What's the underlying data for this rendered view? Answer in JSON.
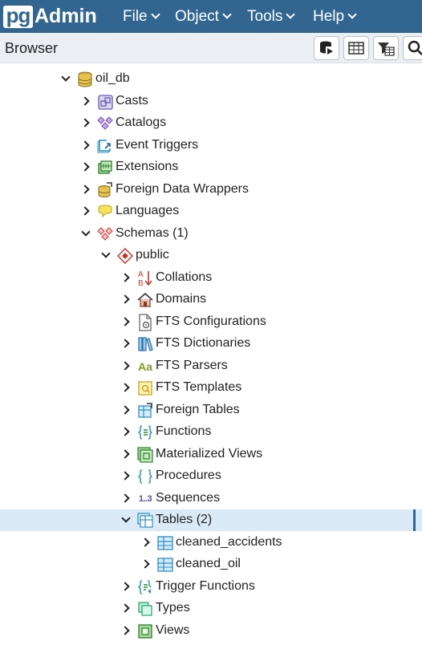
{
  "app": {
    "logo_pg": "pg",
    "logo_admin": "Admin"
  },
  "menu": [
    {
      "label": "File"
    },
    {
      "label": "Object"
    },
    {
      "label": "Tools"
    },
    {
      "label": "Help"
    }
  ],
  "browser": {
    "title": "Browser"
  },
  "tree": {
    "db": "oil_db",
    "casts": "Casts",
    "catalogs": "Catalogs",
    "event_triggers": "Event Triggers",
    "extensions": "Extensions",
    "fdw": "Foreign Data Wrappers",
    "languages": "Languages",
    "schemas": "Schemas (1)",
    "public": "public",
    "collations": "Collations",
    "domains": "Domains",
    "fts_config": "FTS Configurations",
    "fts_dict": "FTS Dictionaries",
    "fts_parsers": "FTS Parsers",
    "fts_templates": "FTS Templates",
    "foreign_tables": "Foreign Tables",
    "functions": "Functions",
    "mat_views": "Materialized Views",
    "procedures": "Procedures",
    "sequences": "Sequences",
    "tables": "Tables (2)",
    "t1": "cleaned_accidents",
    "t2": "cleaned_oil",
    "trigger_functions": "Trigger Functions",
    "types": "Types",
    "views": "Views"
  },
  "glyphs": {
    "collation_a": "A",
    "collation_b": "B",
    "fts_parsers": "Aa",
    "sequences": "1..3"
  },
  "colors": {
    "navbar": "#326690",
    "selected_row": "#dbeaf7",
    "toolbar": "#ebeef3"
  }
}
